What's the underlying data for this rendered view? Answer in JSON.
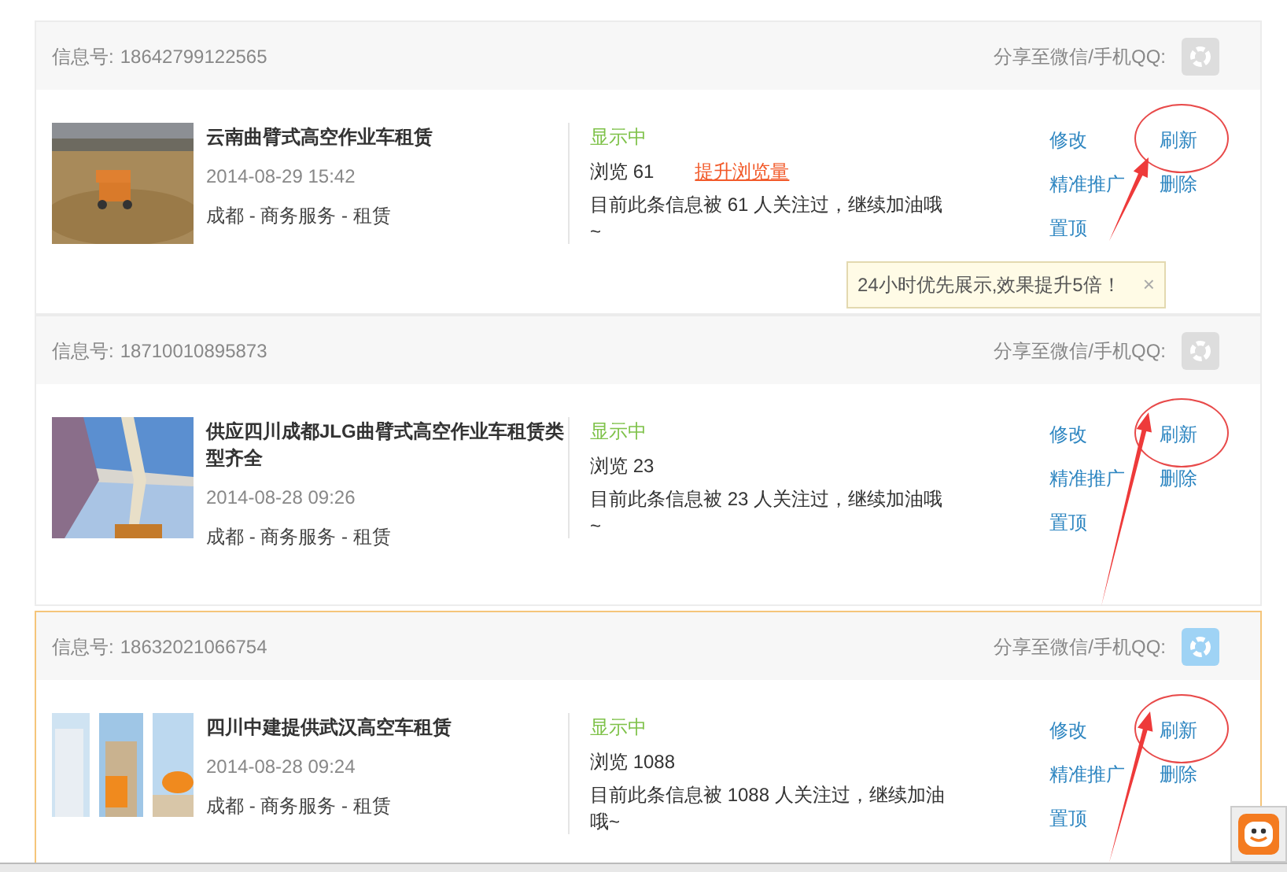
{
  "listings": [
    {
      "info_label": "信息号:",
      "info_number": "18642799122565",
      "share_label": "分享至微信/手机QQ:",
      "highlighted": false,
      "title": "云南曲臂式高空作业车租赁",
      "date": "2014-08-29 15:42",
      "category": "成都 - 商务服务 - 租赁",
      "status": "显示中",
      "views": "浏览 61",
      "boost_link": "提升浏览量",
      "note": "目前此条信息被 61 人关注过，继续加油哦~",
      "actions": [
        {
          "label": "修改",
          "circled": false
        },
        {
          "label": "刷新",
          "circled": true
        },
        {
          "label": "精准推广",
          "circled": false
        },
        {
          "label": "删除",
          "circled": false
        },
        {
          "label": "置顶",
          "circled": false
        }
      ],
      "tooltip": {
        "text": "24小时优先展示,效果提升5倍！",
        "close": "×"
      }
    },
    {
      "info_label": "信息号:",
      "info_number": "18710010895873",
      "share_label": "分享至微信/手机QQ:",
      "highlighted": false,
      "title": "供应四川成都JLG曲臂式高空作业车租赁类型齐全",
      "date": "2014-08-28 09:26",
      "category": "成都 - 商务服务 - 租赁",
      "status": "显示中",
      "views": "浏览 23",
      "note": "目前此条信息被 23 人关注过，继续加油哦~",
      "actions": [
        {
          "label": "修改",
          "circled": false
        },
        {
          "label": "刷新",
          "circled": true
        },
        {
          "label": "精准推广",
          "circled": false
        },
        {
          "label": "删除",
          "circled": false
        },
        {
          "label": "置顶",
          "circled": false
        }
      ]
    },
    {
      "info_label": "信息号:",
      "info_number": "18632021066754",
      "share_label": "分享至微信/手机QQ:",
      "highlighted": true,
      "title": "四川中建提供武汉高空车租赁",
      "date": "2014-08-28 09:24",
      "category": "成都 - 商务服务 - 租赁",
      "status": "显示中",
      "views": "浏览 1088",
      "note": "目前此条信息被 1088 人关注过，继续加油哦~",
      "actions": [
        {
          "label": "修改",
          "circled": false
        },
        {
          "label": "刷新",
          "circled": true
        },
        {
          "label": "精准推广",
          "circled": false
        },
        {
          "label": "删除",
          "circled": false
        },
        {
          "label": "置顶",
          "circled": false
        }
      ]
    }
  ]
}
